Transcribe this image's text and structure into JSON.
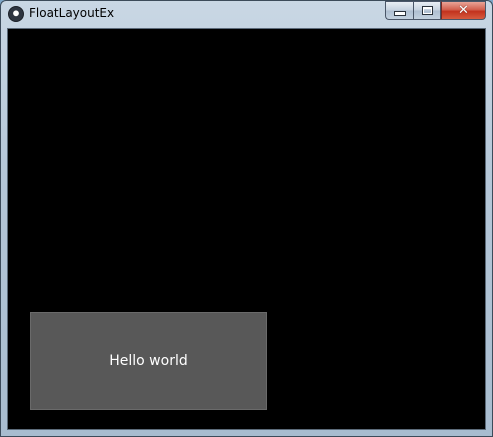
{
  "window": {
    "title": "FloatLayoutEx",
    "icon": "kivy-app-icon",
    "caption_buttons": {
      "minimize_icon": "minimize-icon",
      "maximize_icon": "maximize-icon",
      "close_glyph": "✕"
    }
  },
  "content": {
    "background_color": "#000000",
    "button": {
      "label": "Hello world",
      "color": "#585858"
    }
  }
}
